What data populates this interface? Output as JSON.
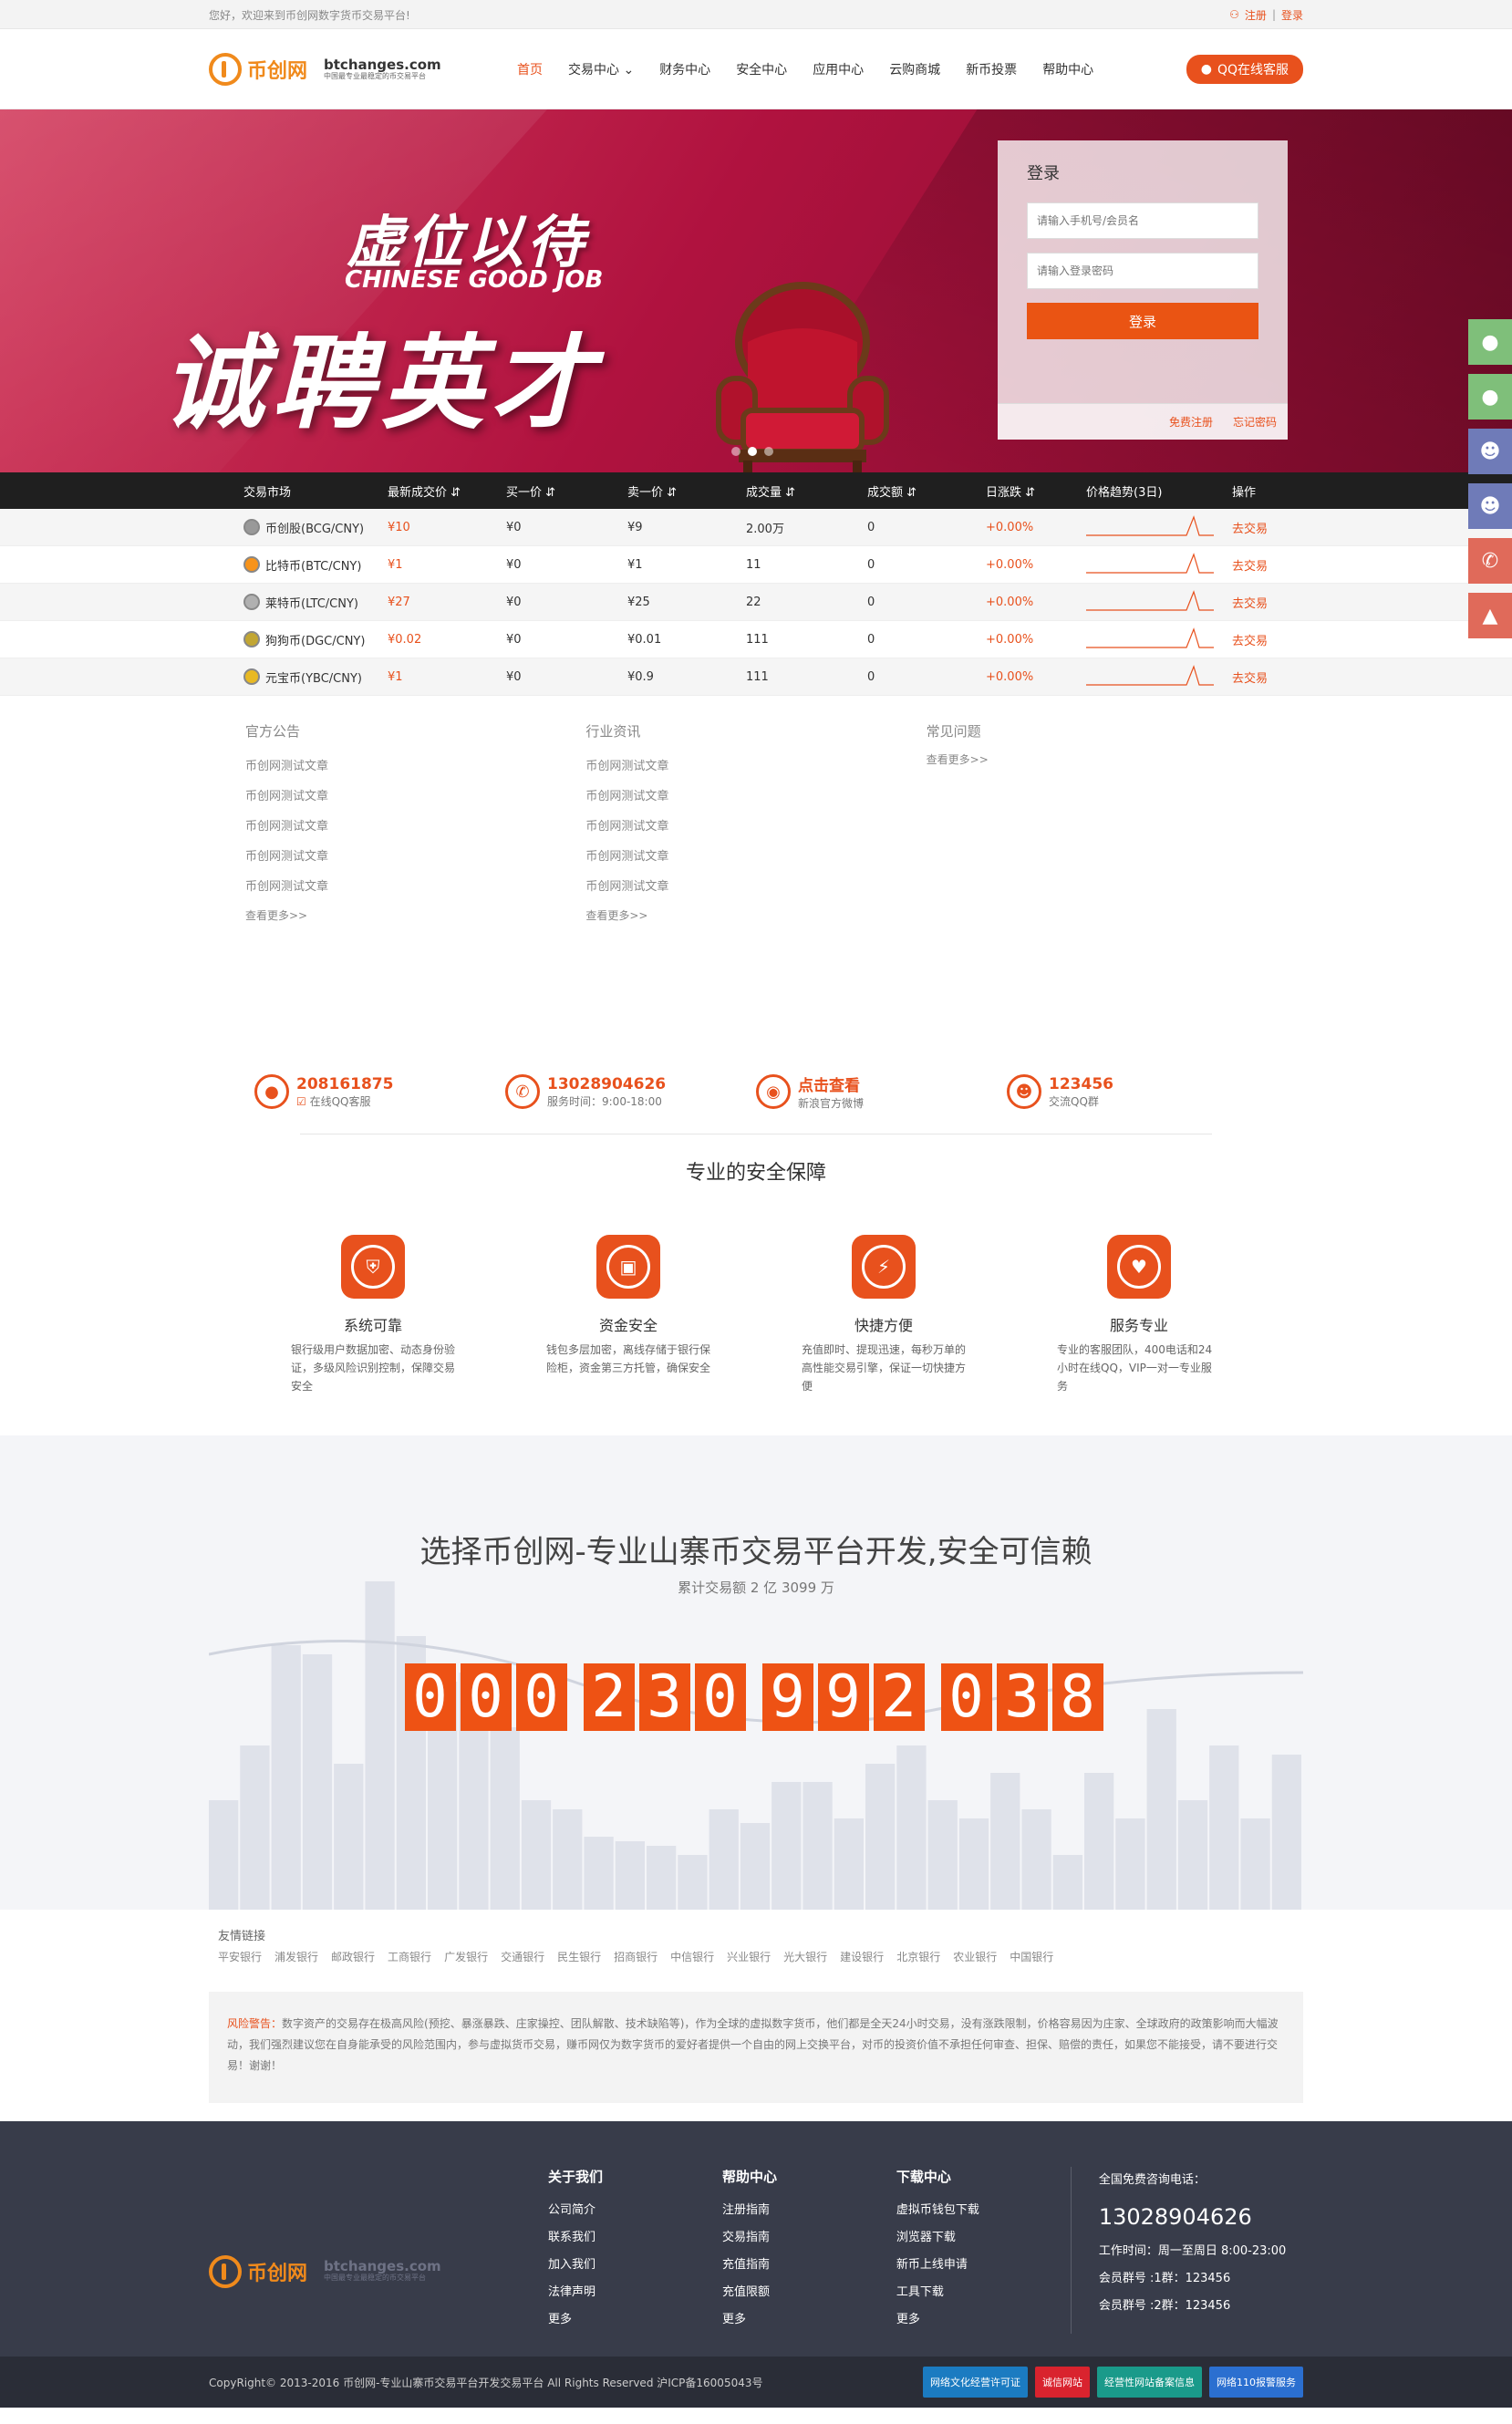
{
  "topbar": {
    "welcome": "您好，欢迎来到币创网数字货币交易平台!",
    "register": "注册",
    "login": "登录"
  },
  "header": {
    "logo_text": "币创网",
    "logo_domain": "btchanges.com",
    "logo_sub": "中国最专业最稳定的币交易平台",
    "nav": [
      "首页",
      "交易中心",
      "财务中心",
      "安全中心",
      "应用中心",
      "云购商城",
      "新币投票",
      "帮助中心"
    ],
    "qq_button": "QQ在线客服"
  },
  "banner": {
    "title1": "虚位以待",
    "title_en": "CHINESE GOOD JOB",
    "title2": "诚聘英才",
    "login_title": "登录",
    "phone_placeholder": "请输入手机号/会员名",
    "password_placeholder": "请输入登录密码",
    "login_button": "登录",
    "free_register": "免费注册",
    "forgot": "忘记密码"
  },
  "market": {
    "headers": [
      "交易市场",
      "最新成交价",
      "买一价",
      "卖一价",
      "成交量",
      "成交额",
      "日涨跌",
      "价格趋势(3日)",
      "操作"
    ],
    "rows": [
      {
        "name": "币创股(BCG/CNY)",
        "last": "¥10",
        "buy": "¥0",
        "sell": "¥9",
        "volume": "2.00万",
        "amount": "0",
        "change": "+0.00%",
        "action": "去交易"
      },
      {
        "name": "比特币(BTC/CNY)",
        "last": "¥1",
        "buy": "¥0",
        "sell": "¥1",
        "volume": "11",
        "amount": "0",
        "change": "+0.00%",
        "action": "去交易"
      },
      {
        "name": "莱特币(LTC/CNY)",
        "last": "¥27",
        "buy": "¥0",
        "sell": "¥25",
        "volume": "22",
        "amount": "0",
        "change": "+0.00%",
        "action": "去交易"
      },
      {
        "name": "狗狗币(DGC/CNY)",
        "last": "¥0.02",
        "buy": "¥0",
        "sell": "¥0.01",
        "volume": "111",
        "amount": "0",
        "change": "+0.00%",
        "action": "去交易"
      },
      {
        "name": "元宝币(YBC/CNY)",
        "last": "¥1",
        "buy": "¥0",
        "sell": "¥0.9",
        "volume": "111",
        "amount": "0",
        "change": "+0.00%",
        "action": "去交易"
      }
    ]
  },
  "news": [
    {
      "title": "官方公告",
      "items": [
        "币创网测试文章",
        "币创网测试文章",
        "币创网测试文章",
        "币创网测试文章",
        "币创网测试文章"
      ],
      "more": "查看更多>>"
    },
    {
      "title": "行业资讯",
      "items": [
        "币创网测试文章",
        "币创网测试文章",
        "币创网测试文章",
        "币创网测试文章",
        "币创网测试文章"
      ],
      "more": "查看更多>>"
    },
    {
      "title": "常见问题",
      "items": [],
      "more": "查看更多>>"
    }
  ],
  "contacts": [
    {
      "num": "208161875",
      "sub": "在线QQ客服"
    },
    {
      "num": "13028904626",
      "sub": "服务时间：9:00-18:00"
    },
    {
      "num": "点击查看",
      "sub": "新浪官方微博"
    },
    {
      "num": "123456",
      "sub": "交流QQ群"
    }
  ],
  "security": {
    "title": "专业的安全保障",
    "features": [
      {
        "title": "系统可靠",
        "desc": "银行级用户数据加密、动态身份验证，多级风险识别控制，保障交易安全"
      },
      {
        "title": "资金安全",
        "desc": "钱包多层加密，离线存储于银行保险柜，资金第三方托管，确保安全"
      },
      {
        "title": "快捷方便",
        "desc": "充值即时、提现迅速，每秒万单的高性能交易引擎，保证一切快捷方便"
      },
      {
        "title": "服务专业",
        "desc": "专业的客服团队，400电话和24小时在线QQ，VIP一对一专业服务"
      }
    ]
  },
  "stats": {
    "title": "选择币创网-专业山寨币交易平台开发,安全可信赖",
    "sub": "累计交易额 2 亿 3099 万",
    "digits": [
      "000",
      "230",
      "992",
      "038"
    ]
  },
  "links": {
    "title": "友情链接",
    "items": [
      "平安银行",
      "浦发银行",
      "邮政银行",
      "工商银行",
      "广发银行",
      "交通银行",
      "民生银行",
      "招商银行",
      "中信银行",
      "兴业银行",
      "光大银行",
      "建设银行",
      "北京银行",
      "农业银行",
      "中国银行"
    ]
  },
  "risk": {
    "label": "风险警告：",
    "text": "数字资产的交易存在极高风险(预挖、暴涨暴跌、庄家操控、团队解散、技术缺陷等)，作为全球的虚拟数字货币，他们都是全天24小时交易，没有涨跌限制，价格容易因为庄家、全球政府的政策影响而大幅波动，我们强烈建议您在自身能承受的风险范围内，参与虚拟货币交易，赚币网仅为数字货币的爱好者提供一个自由的网上交换平台，对币的投资价值不承担任何审查、担保、赔偿的责任，如果您不能接受，请不要进行交易！谢谢！"
  },
  "footer": {
    "cols": [
      {
        "title": "关于我们",
        "items": [
          "公司简介",
          "联系我们",
          "加入我们",
          "法律声明",
          "更多"
        ]
      },
      {
        "title": "帮助中心",
        "items": [
          "注册指南",
          "交易指南",
          "充值指南",
          "充值限额",
          "更多"
        ]
      },
      {
        "title": "下载中心",
        "items": [
          "虚拟币钱包下载",
          "浏览器下载",
          "新币上线申请",
          "工具下载",
          "更多"
        ]
      }
    ],
    "hotline_label": "全国免费咨询电话：",
    "hotline": "13028904626",
    "hours": "工作时间：周一至周日 8:00-23:00",
    "group1": "会员群号 :1群：123456",
    "group2": "会员群号 :2群：123456",
    "copyright": "CopyRight© 2013-2016 币创网-专业山寨币交易平台开发交易平台 All Rights Reserved   沪ICP备16005043号",
    "badges": [
      "网络文化经营许可证",
      "诚信网站",
      "经营性网站备案信息",
      "网络110报警服务"
    ]
  },
  "colors": {
    "accent": "#e8511d",
    "footer_bg": "#383c4a",
    "side_green": "#7fbf7a",
    "side_blue": "#6f7bb8",
    "side_red": "#e06a5a"
  }
}
